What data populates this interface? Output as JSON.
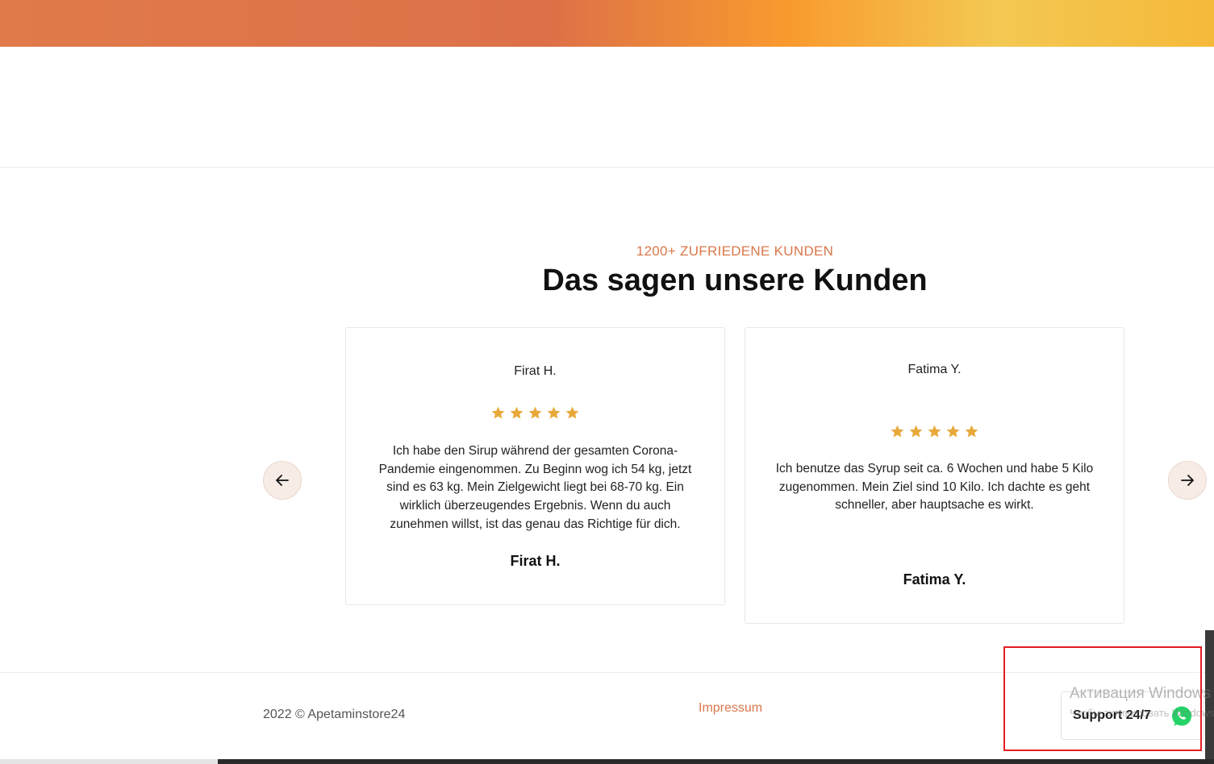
{
  "section": {
    "eyebrow": "1200+ ZUFRIEDENE KUNDEN",
    "heading": "Das sagen unsere Kunden"
  },
  "testimonials": [
    {
      "name": "Firat H.",
      "rating": 5,
      "quote": "Ich habe den Sirup während der gesamten Corona-Pandemie eingenommen. Zu Beginn wog ich 54 kg, jetzt sind es 63 kg. Mein Zielgewicht liegt bei 68-70 kg. Ein wirklich überzeugendes Ergebnis. Wenn du auch zunehmen willst, ist das genau das Richtige für dich.",
      "author": "Firat H."
    },
    {
      "name": "Fatima Y.",
      "rating": 5,
      "quote": "Ich benutze das Syrup seit ca. 6 Wochen und habe 5 Kilo zugenommen. Mein Ziel sind 10 Kilo. Ich dachte es geht schneller, aber hauptsache es wirkt.",
      "author": "Fatima Y."
    }
  ],
  "icons": {
    "star": "star-icon",
    "prev": "arrow-left-icon",
    "next": "arrow-right-icon",
    "whatsapp": "whatsapp-icon"
  },
  "footer": {
    "copyright": "2022 © Apetaminstore24",
    "impressum": "Impressum"
  },
  "support": {
    "label": "Support 24/7"
  },
  "windows_overlay": {
    "title": "Активация Windows",
    "subtitle": "Чтобы активировать Windows"
  },
  "colors": {
    "accent": "#d9774a",
    "star": "#e8a93a",
    "whatsapp": "#25d366",
    "highlight_frame": "#e31e24"
  }
}
